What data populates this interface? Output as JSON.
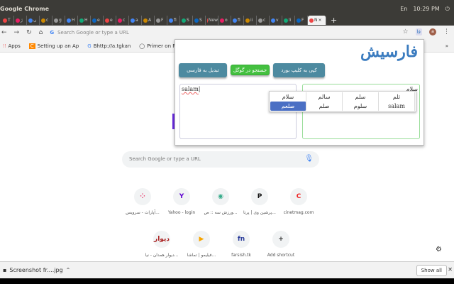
{
  "system": {
    "app_title": "Google Chrome",
    "time": "10:29 PM",
    "keyboard": "En"
  },
  "tabs": [
    "T",
    "ژ",
    "ں",
    "c",
    "g",
    "H",
    "H",
    "e",
    "e",
    "c",
    "a",
    "A",
    "F",
    "fi",
    "S",
    "S",
    "New",
    "o",
    "fi",
    "ii",
    "c",
    "v",
    "li",
    "F",
    "N"
  ],
  "toolbar": {
    "omnibox_placeholder": "Search Google or type a URL",
    "avatar": "a",
    "ext_icon": "فا"
  },
  "bookmarks": [
    "Apps",
    "Setting up an Ap",
    "Bhttp://a.tgkan",
    "Primer on Pyt"
  ],
  "popup": {
    "title": "فارسیش",
    "buttons": {
      "convert": "تبدیل به فارسی",
      "google": "جستجو در گوگل",
      "copy": "کپی به کلیپ بورد"
    },
    "input_text": "salam",
    "output_text": "سلام",
    "suggestions": [
      "سلام",
      "سالم",
      "سلم",
      "ثلم",
      "صلعم",
      "صلم",
      "سلوم",
      "salam"
    ],
    "selected_suggestion": "صلعم"
  },
  "page": {
    "search_placeholder": "Search Google or type a URL",
    "shortcuts": [
      {
        "label": "آپارات - سرویس...",
        "icon": "⁘",
        "color": "#e8245c"
      },
      {
        "label": "Yahoo - login",
        "icon": "Y",
        "color": "#5f01d1"
      },
      {
        "label": "ورزش سه :: ص...",
        "icon": "◉",
        "color": "#3a8"
      },
      {
        "label": "پرشین وی | پرتا...",
        "icon": "P",
        "color": "#111"
      },
      {
        "label": "cinetmag.com",
        "icon": "C",
        "color": "#e22"
      },
      {
        "label": "دیوار همدان - نیا...",
        "icon": "دیوار",
        "color": "#a22"
      },
      {
        "label": "فیلیمو | تماشا...",
        "icon": "▶",
        "color": "#f7a400"
      },
      {
        "label": "farsish.tk",
        "icon": "fn",
        "color": "#2a3c9a"
      },
      {
        "label": "Add shortcut",
        "icon": "+",
        "color": "#333"
      }
    ]
  },
  "download": {
    "filename": "Screenshot fr....jpg",
    "show_all": "Show all"
  }
}
